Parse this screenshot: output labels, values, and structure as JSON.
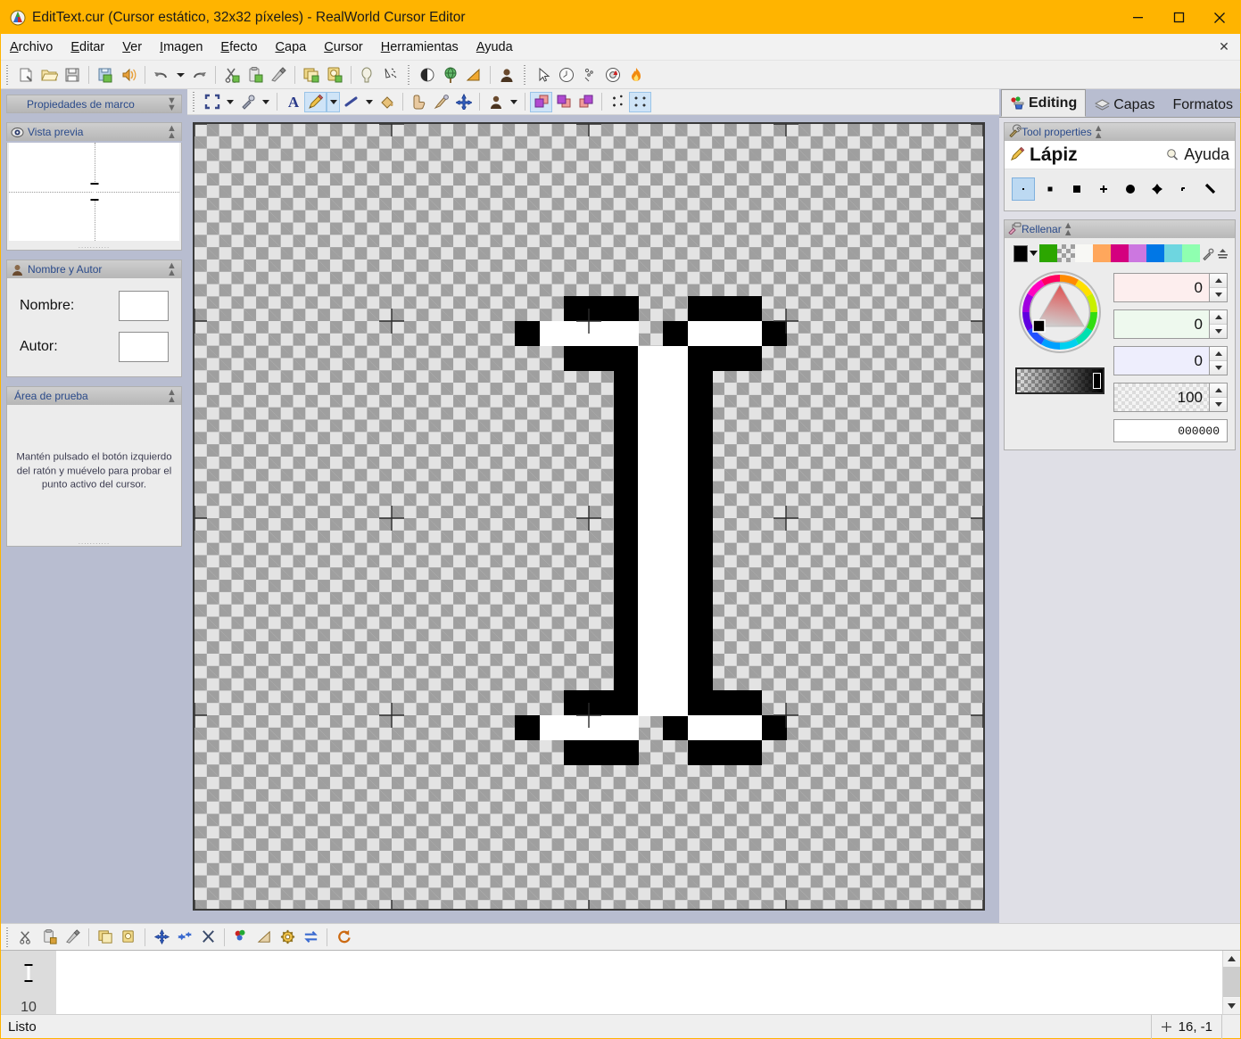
{
  "window": {
    "title": "EditText.cur (Cursor estático, 32x32 píxeles) - RealWorld Cursor Editor",
    "app_icon": "realworld-cursor-editor-icon",
    "minimize_label": "—",
    "maximize_label": "□",
    "close_label": "✕",
    "titlebar_color": "#ffb400"
  },
  "menu": {
    "items": [
      {
        "label": "Archivo",
        "accel": "A"
      },
      {
        "label": "Editar",
        "accel": "E"
      },
      {
        "label": "Ver",
        "accel": "V"
      },
      {
        "label": "Imagen",
        "accel": "I"
      },
      {
        "label": "Efecto",
        "accel": "E"
      },
      {
        "label": "Capa",
        "accel": "C"
      },
      {
        "label": "Cursor",
        "accel": "C"
      },
      {
        "label": "Herramientas",
        "accel": "H"
      },
      {
        "label": "Ayuda",
        "accel": "A"
      }
    ],
    "close_document_label": "✕"
  },
  "main_toolbar": {
    "groups": [
      [
        "new-document-icon",
        "open-folder-icon",
        "save-icon"
      ],
      [
        "save-as-image-icon",
        "publish-icon"
      ],
      [
        "undo-icon",
        "undo-dropdown-icon",
        "redo-icon"
      ],
      [
        "cut-icon",
        "copy-icon",
        "paste-icon"
      ],
      [
        "copy-layer-icon",
        "paste-layer-icon"
      ],
      [
        "select-none-icon",
        "select-invert-icon"
      ],
      [
        "brightness-icon",
        "colorize-icon",
        "gradient-icon",
        "avatar-icon"
      ],
      [
        "pointer-icon",
        "clock-icon",
        "sparkle-icon",
        "lifebuoy-icon",
        "flame-icon"
      ]
    ]
  },
  "canvas_toolbar": {
    "buttons": [
      {
        "name": "selection-tool",
        "icon": "selection-icon",
        "selected": false,
        "has_dropdown": true
      },
      {
        "name": "eyedropper-tool",
        "icon": "eyedropper-icon",
        "selected": false,
        "has_dropdown": true
      },
      {
        "name": "text-tool",
        "icon": "text-a-icon",
        "selected": false,
        "has_dropdown": false
      },
      {
        "name": "pencil-tool",
        "icon": "pencil-icon",
        "selected": true,
        "has_dropdown": true
      },
      {
        "name": "line-tool",
        "icon": "line-icon",
        "selected": false,
        "has_dropdown": true
      },
      {
        "name": "fill-tool",
        "icon": "paint-bucket-icon",
        "selected": false,
        "has_dropdown": false
      },
      {
        "name": "smudge-tool",
        "icon": "finger-icon",
        "selected": false,
        "has_dropdown": false
      },
      {
        "name": "brush-tool",
        "icon": "brush-icon",
        "selected": false,
        "has_dropdown": false
      },
      {
        "name": "hotspot-tool",
        "icon": "hotspot-cross-icon",
        "selected": false,
        "has_dropdown": false
      },
      {
        "name": "avatar-tool",
        "icon": "avatar-icon",
        "selected": false,
        "has_dropdown": true
      },
      {
        "name": "layer-front",
        "icon": "layers-front-icon",
        "selected": true,
        "has_dropdown": false
      },
      {
        "name": "layer-middle",
        "icon": "layers-middle-icon",
        "selected": false,
        "has_dropdown": false
      },
      {
        "name": "layer-back",
        "icon": "layers-back-icon",
        "selected": false,
        "has_dropdown": false
      },
      {
        "name": "grid-small",
        "icon": "grid-sparse-icon",
        "selected": false,
        "has_dropdown": false
      },
      {
        "name": "grid-large",
        "icon": "grid-dense-icon",
        "selected": true,
        "has_dropdown": false
      }
    ]
  },
  "left_panel": {
    "frame_properties": {
      "title": "Propiedades de marco",
      "collapsed": true,
      "chevron": "double-down-chevron-icon"
    },
    "preview": {
      "title": "Vista previa",
      "icon": "eye-icon",
      "chevron": "double-up-chevron-icon"
    },
    "name_author": {
      "title": "Nombre y Autor",
      "icon": "person-icon",
      "chevron": "double-up-chevron-icon",
      "fields": [
        {
          "label": "Nombre:",
          "value": "",
          "placeholder": ""
        },
        {
          "label": "Autor:",
          "value": "",
          "placeholder": ""
        }
      ]
    },
    "test_area": {
      "title": "Área de prueba",
      "chevron": "double-up-chevron-icon",
      "text": "Mantén pulsado el botón izquierdo del ratón y muévelo para probar el punto activo del cursor."
    }
  },
  "right_panel": {
    "tabs": [
      {
        "label": "Editing",
        "icon": "paint-palette-icon",
        "active": true
      },
      {
        "label": "Capas",
        "icon": "layers-stack-icon",
        "active": false
      },
      {
        "label": "Formatos",
        "icon": "",
        "active": false
      }
    ],
    "tool_properties": {
      "title": "Tool properties",
      "icon": "wrench-icon",
      "chevron": "double-up-chevron-icon",
      "tool_name": "Lápiz",
      "tool_icon": "pencil-icon",
      "help_label": "Ayuda",
      "help_icon": "lightbulb-icon",
      "brushes": [
        {
          "name": "brush-1px",
          "selected": true
        },
        {
          "name": "brush-2px-square",
          "selected": false
        },
        {
          "name": "brush-4px-square",
          "selected": false
        },
        {
          "name": "brush-cross-small",
          "selected": false
        },
        {
          "name": "brush-round-large",
          "selected": false
        },
        {
          "name": "brush-diamond",
          "selected": false
        },
        {
          "name": "brush-dot-slanted",
          "selected": false
        },
        {
          "name": "brush-line-diagonal",
          "selected": false
        }
      ]
    },
    "fill": {
      "title": "Rellenar",
      "icon": "paint-roller-icon",
      "chevron": "double-up-chevron-icon",
      "current_color": "#000000",
      "dropdown_icon": "chevron-down-icon",
      "palette": [
        "#2ca600",
        "checker",
        "#f8f8f5",
        "#ffa75c",
        "#d4007f",
        "#cc77e0",
        "#0077e6",
        "#6ed6e0",
        "#8fffb0"
      ],
      "eyedropper_icon": "eyedropper-icon",
      "palette_manage_icon": "palette-manage-icon",
      "channels": [
        {
          "name": "red",
          "value": "0",
          "tint": "#fdeeee"
        },
        {
          "name": "green",
          "value": "0",
          "tint": "#eef9ee"
        },
        {
          "name": "blue",
          "value": "0",
          "tint": "#eeeefd"
        },
        {
          "name": "alpha",
          "value": "100",
          "tint": "checker"
        }
      ],
      "hex_value": "000000",
      "wheel_icon": "color-wheel-icon",
      "alpha_slider_name": "alpha-gradient-slider"
    }
  },
  "bottom_toolbar": {
    "buttons": [
      "cut-frame-icon",
      "copy-frame-icon",
      "paste-frame-icon",
      "duplicate-frame-icon",
      "import-frame-icon",
      "add-frame-icon",
      "add-frames-icon",
      "delete-frame-icon",
      "color-depth-icon",
      "resize-icon",
      "settings-gear-icon",
      "swap-icon",
      "refresh-icon"
    ]
  },
  "frame_strip": {
    "frame_icon": "text-cursor-ibeam-icon",
    "frame_number": "10",
    "scroll_up_icon": "chevron-up-icon",
    "scroll_down_icon": "chevron-down-icon"
  },
  "status_bar": {
    "message": "Listo",
    "cursor_icon": "crosshair-icon",
    "coordinates": "16, -1"
  },
  "canvas": {
    "image_size": "32x32",
    "grid_cells": 32,
    "background": "transparent-checker",
    "guide_marks_every": 8,
    "pixels": {
      "black": [
        [
          15,
          7
        ],
        [
          16,
          7
        ],
        [
          17,
          7
        ],
        [
          20,
          7
        ],
        [
          21,
          7
        ],
        [
          22,
          7
        ],
        [
          13,
          8
        ],
        [
          14,
          8
        ],
        [
          19,
          8
        ],
        [
          23,
          8
        ],
        [
          15,
          9
        ],
        [
          16,
          9
        ],
        [
          17,
          9
        ],
        [
          20,
          9
        ],
        [
          21,
          9
        ],
        [
          22,
          9
        ],
        [
          17,
          10
        ],
        [
          20,
          10
        ],
        [
          17,
          11
        ],
        [
          20,
          11
        ],
        [
          17,
          12
        ],
        [
          20,
          12
        ],
        [
          17,
          13
        ],
        [
          20,
          13
        ],
        [
          17,
          14
        ],
        [
          20,
          14
        ],
        [
          17,
          15
        ],
        [
          20,
          15
        ],
        [
          17,
          16
        ],
        [
          20,
          16
        ],
        [
          17,
          17
        ],
        [
          20,
          17
        ],
        [
          17,
          18
        ],
        [
          20,
          18
        ],
        [
          17,
          19
        ],
        [
          20,
          19
        ],
        [
          17,
          20
        ],
        [
          20,
          20
        ],
        [
          17,
          21
        ],
        [
          20,
          21
        ],
        [
          17,
          22
        ],
        [
          20,
          22
        ],
        [
          15,
          23
        ],
        [
          16,
          23
        ],
        [
          17,
          23
        ],
        [
          20,
          23
        ],
        [
          21,
          23
        ],
        [
          22,
          23
        ],
        [
          13,
          24
        ],
        [
          14,
          24
        ],
        [
          19,
          24
        ],
        [
          23,
          24
        ],
        [
          15,
          25
        ],
        [
          16,
          25
        ],
        [
          17,
          25
        ],
        [
          20,
          25
        ],
        [
          21,
          25
        ],
        [
          22,
          25
        ]
      ],
      "white": [
        [
          14,
          8
        ],
        [
          15,
          8
        ],
        [
          16,
          8
        ],
        [
          17,
          8
        ],
        [
          20,
          8
        ],
        [
          21,
          8
        ],
        [
          22,
          8
        ],
        [
          18,
          9
        ],
        [
          19,
          9
        ],
        [
          18,
          10
        ],
        [
          19,
          10
        ],
        [
          18,
          11
        ],
        [
          19,
          11
        ],
        [
          18,
          12
        ],
        [
          19,
          12
        ],
        [
          18,
          13
        ],
        [
          19,
          13
        ],
        [
          18,
          14
        ],
        [
          19,
          14
        ],
        [
          18,
          15
        ],
        [
          19,
          15
        ],
        [
          18,
          16
        ],
        [
          19,
          16
        ],
        [
          18,
          17
        ],
        [
          19,
          17
        ],
        [
          18,
          18
        ],
        [
          19,
          18
        ],
        [
          18,
          19
        ],
        [
          19,
          19
        ],
        [
          18,
          20
        ],
        [
          19,
          20
        ],
        [
          18,
          21
        ],
        [
          19,
          21
        ],
        [
          18,
          22
        ],
        [
          19,
          22
        ],
        [
          18,
          23
        ],
        [
          19,
          23
        ],
        [
          14,
          24
        ],
        [
          15,
          24
        ],
        [
          16,
          24
        ],
        [
          17,
          24
        ],
        [
          20,
          24
        ],
        [
          21,
          24
        ],
        [
          22,
          24
        ]
      ]
    }
  }
}
